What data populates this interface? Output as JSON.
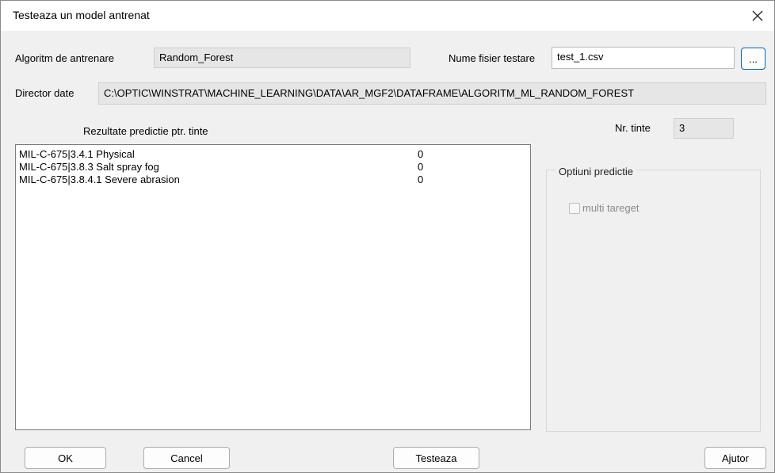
{
  "window": {
    "title": "Testeaza un model antrenat"
  },
  "icons": {
    "close": "close-icon"
  },
  "algorithm": {
    "label": "Algoritm de antrenare",
    "value": "Random_Forest"
  },
  "test_file": {
    "label": "Nume fisier testare",
    "value": "test_1.csv",
    "browse_label": "..."
  },
  "data_dir": {
    "label": "Director date",
    "value": "C:\\OPTIC\\WINSTRAT\\MACHINE_LEARNING\\DATA\\AR_MGF2\\DATAFRAME\\ALGORITM_ML_RANDOM_FOREST"
  },
  "results": {
    "label": "Rezultate predictie ptr. tinte",
    "rows": [
      {
        "name": "MIL-C-675|3.4.1 Physical",
        "value": "0"
      },
      {
        "name": "MIL-C-675|3.8.3 Salt spray fog",
        "value": "0"
      },
      {
        "name": "MIL-C-675|3.8.4.1 Severe abrasion",
        "value": "0"
      }
    ]
  },
  "targets": {
    "label": "Nr. tinte",
    "value": "3"
  },
  "options": {
    "legend": "Optiuni predictie",
    "multi_label": "multi tareget",
    "multi_checked": false,
    "multi_enabled": false
  },
  "buttons": {
    "ok": "OK",
    "cancel": "Cancel",
    "test": "Testeaza",
    "help": "Ajutor"
  }
}
